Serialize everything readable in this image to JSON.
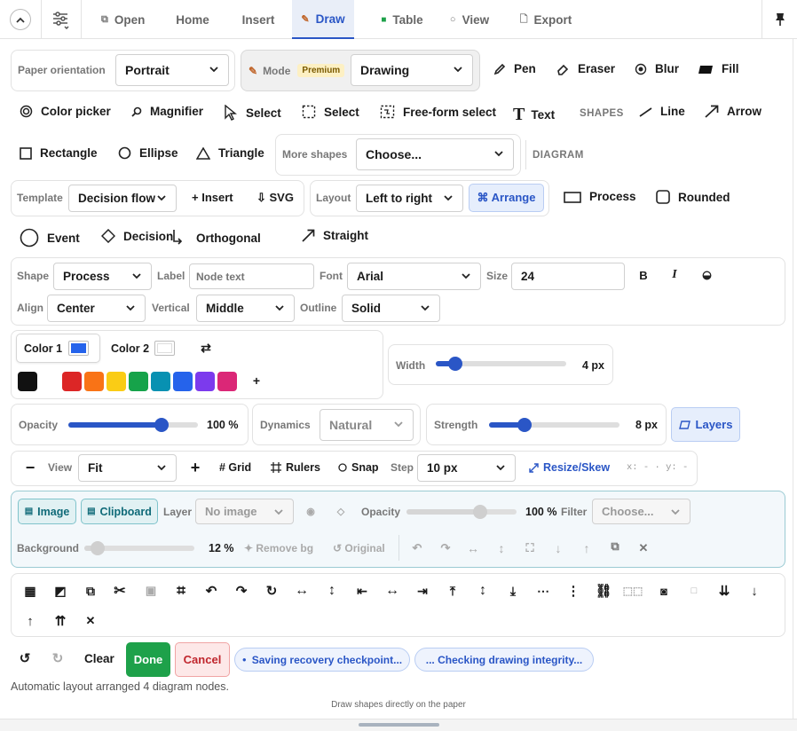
{
  "topbar": {
    "tabs": [
      {
        "label": "Open",
        "icon": "open-icon"
      },
      {
        "label": "Home"
      },
      {
        "label": "Insert"
      },
      {
        "label": "Draw",
        "icon": "draw-icon"
      },
      {
        "label": "Table",
        "icon": "table-icon"
      },
      {
        "label": "View",
        "icon": "view-icon"
      },
      {
        "label": "Export",
        "icon": "export-icon"
      }
    ]
  },
  "row1": {
    "paper_label": "Paper orientation",
    "paper_value": "Portrait",
    "mode_label": "Mode",
    "premium": "Premium",
    "mode_value": "Drawing",
    "pen": "Pen",
    "eraser": "Eraser",
    "blur": "Blur",
    "fill": "Fill"
  },
  "row2": {
    "color_picker": "Color picker",
    "magnifier": "Magnifier",
    "select1": "Select",
    "select2": "Select",
    "freeform": "Free-form select",
    "text": "Text",
    "shapes_heading": "SHAPES",
    "line": "Line",
    "arrow": "Arrow"
  },
  "row3": {
    "rectangle": "Rectangle",
    "ellipse": "Ellipse",
    "triangle": "Triangle",
    "more_label": "More shapes",
    "more_value": "Choose...",
    "diagram_heading": "DIAGRAM"
  },
  "row4": {
    "template_label": "Template",
    "template_value": "Decision flow",
    "insert": "+ Insert",
    "svg": "⇩ SVG",
    "layout_label": "Layout",
    "layout_value": "Left to right",
    "arrange": "⌘ Arrange",
    "process": "Process",
    "rounded": "Rounded"
  },
  "row5": {
    "event": "Event",
    "decision": "Decision",
    "orthogonal": "Orthogonal",
    "straight": "Straight"
  },
  "shape_panel": {
    "shape_label": "Shape",
    "shape_value": "Process",
    "label_label": "Label",
    "label_placeholder": "Node text",
    "font_label": "Font",
    "font_value": "Arial",
    "size_label": "Size",
    "size_value": "24",
    "bold": "B",
    "italic": "I",
    "align_label": "Align",
    "align_value": "Center",
    "vertical_label": "Vertical",
    "vertical_value": "Middle",
    "outline_label": "Outline",
    "outline_value": "Solid"
  },
  "color_panel": {
    "color1": "Color 1",
    "color2": "Color 2",
    "swap": "⇄",
    "add": "+",
    "swatches": [
      "#111111",
      "#dc2626",
      "#f97316",
      "#facc15",
      "#16a34a",
      "#0891b2",
      "#2563eb",
      "#7c3aed",
      "#db2777"
    ],
    "color1_value": "#2563eb",
    "color2_value": "#ffffff"
  },
  "width_panel": {
    "label": "Width",
    "value": "4 px",
    "level": 0.15
  },
  "row8": {
    "opacity_label": "Opacity",
    "opacity_value": "100 %",
    "opacity_level": 0.72,
    "dynamics_label": "Dynamics",
    "dynamics_value": "Natural",
    "strength_label": "Strength",
    "strength_value": "8 px",
    "strength_level": 0.27,
    "layers": "Layers"
  },
  "row9": {
    "minus": "−",
    "view_label": "View",
    "view_value": "Fit",
    "plus": "+",
    "grid": "# Grid",
    "rulers": "Rulers",
    "snap": "Snap",
    "step_label": "Step",
    "step_value": "10 px",
    "resize": "Resize/Skew",
    "coords": "x: - · y: -"
  },
  "image_panel": {
    "image": "Image",
    "clipboard": "Clipboard",
    "layer_label": "Layer",
    "layer_value": "No image",
    "opacity_label": "Opacity",
    "opacity_value": "100 %",
    "opacity_level": 0.67,
    "filter_label": "Filter",
    "filter_value": "Choose...",
    "background_label": "Background",
    "background_value": "12 %",
    "background_level": 0.12,
    "remove_bg": "✦ Remove bg",
    "original": "↺ Original"
  },
  "footer": {
    "undo": "↺",
    "redo": "↻",
    "clear": "Clear",
    "done": "Done",
    "cancel": "Cancel",
    "pill1": "Saving recovery checkpoint...",
    "pill2": "... Checking drawing integrity...",
    "status": "Automatic layout arranged 4 diagram nodes.",
    "hint": "Draw shapes directly on the paper"
  },
  "colors": {
    "accent": "#2a56c6",
    "done": "#1ea14a",
    "cancel": "#c0262d",
    "teal": "#0f6a78"
  }
}
